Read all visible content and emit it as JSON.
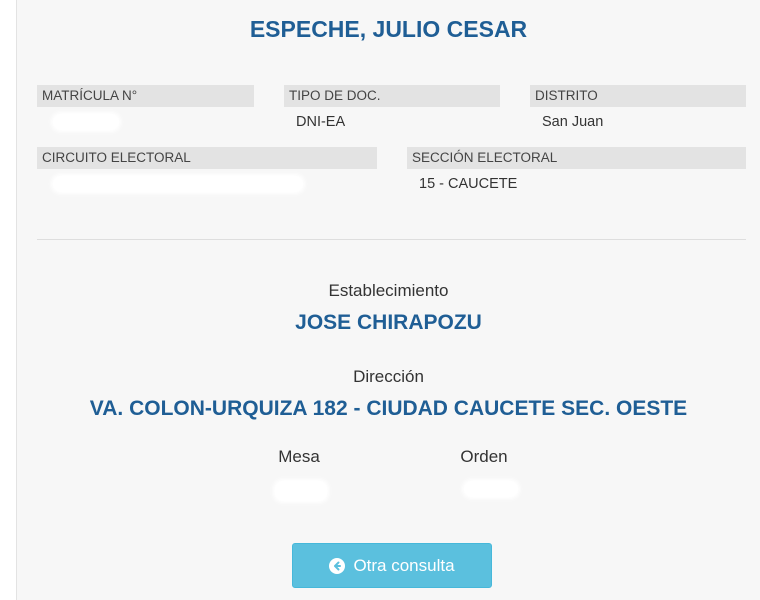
{
  "header": {
    "name": "ESPECHE, JULIO CESAR"
  },
  "fields": {
    "matricula_label": "MATRÍCULA N°",
    "tipo_doc_label": "TIPO DE DOC.",
    "tipo_doc_value": "DNI-EA",
    "distrito_label": "DISTRITO",
    "distrito_value": "San Juan",
    "circuito_label": "CIRCUITO ELECTORAL",
    "seccion_label": "SECCIÓN ELECTORAL",
    "seccion_value": "15 - CAUCETE"
  },
  "establecimiento": {
    "caption": "Establecimiento",
    "value": "JOSE CHIRAPOZU"
  },
  "direccion": {
    "caption": "Dirección",
    "value": "VA. COLON-URQUIZA 182 - CIUDAD CAUCETE SEC. OESTE"
  },
  "mesa": {
    "caption": "Mesa"
  },
  "orden": {
    "caption": "Orden"
  },
  "actions": {
    "otra_consulta_label": "Otra consulta",
    "otra_consulta_icon": "arrow-circle-left-icon"
  },
  "colors": {
    "primary_blue": "#1f5e95",
    "button_info": "#5bc0de",
    "label_bg": "#e3e3e3",
    "card_bg": "#f7f7f7"
  }
}
